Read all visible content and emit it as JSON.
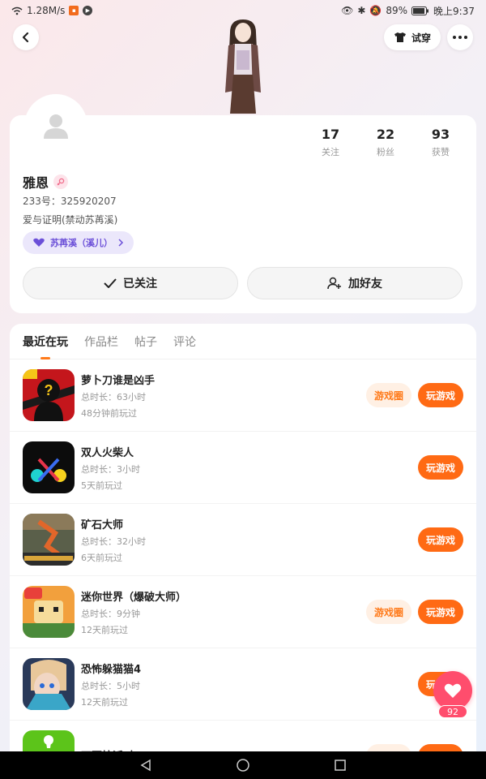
{
  "status": {
    "speed": "1.28M/s",
    "battery": "89%",
    "time": "晚上9:37"
  },
  "header": {
    "tryon_label": "试穿"
  },
  "profile": {
    "stats": [
      {
        "num": "17",
        "label": "关注"
      },
      {
        "num": "22",
        "label": "粉丝"
      },
      {
        "num": "93",
        "label": "获赞"
      }
    ],
    "nickname": "雅恩",
    "uid": "233号：325920207",
    "bio": "爱与证明(禁动苏苒溪)",
    "cp_tag": "苏苒溪（溪儿）",
    "followed_label": "已关注",
    "addfriend_label": "加好友"
  },
  "tabs": [
    "最近在玩",
    "作品栏",
    "帖子",
    "评论"
  ],
  "games": [
    {
      "name": "萝卜刀谁是凶手",
      "duration": "总时长：63小时",
      "last": "48分钟前玩过",
      "circle": "游戏圈",
      "play": "玩游戏"
    },
    {
      "name": "双人火柴人",
      "duration": "总时长：3小时",
      "last": "5天前玩过",
      "circle": "",
      "play": "玩游戏"
    },
    {
      "name": "矿石大师",
      "duration": "总时长：32小时",
      "last": "6天前玩过",
      "circle": "",
      "play": "玩游戏"
    },
    {
      "name": "迷你世界（爆破大师）",
      "duration": "总时长：9分钟",
      "last": "12天前玩过",
      "circle": "游戏圈",
      "play": "玩游戏"
    },
    {
      "name": "恐怖躲猫猫4",
      "duration": "总时长：5小时",
      "last": "12天前玩过",
      "circle": "",
      "play": "玩游戏"
    },
    {
      "name": "不要按派对",
      "duration": "",
      "last": "",
      "circle": "游戏圈",
      "play": "玩游戏"
    }
  ],
  "float": {
    "count": "92"
  },
  "colors": {
    "accent": "#ff6a14",
    "like": "#ff4d6d",
    "cp": "#6b4fd8"
  }
}
